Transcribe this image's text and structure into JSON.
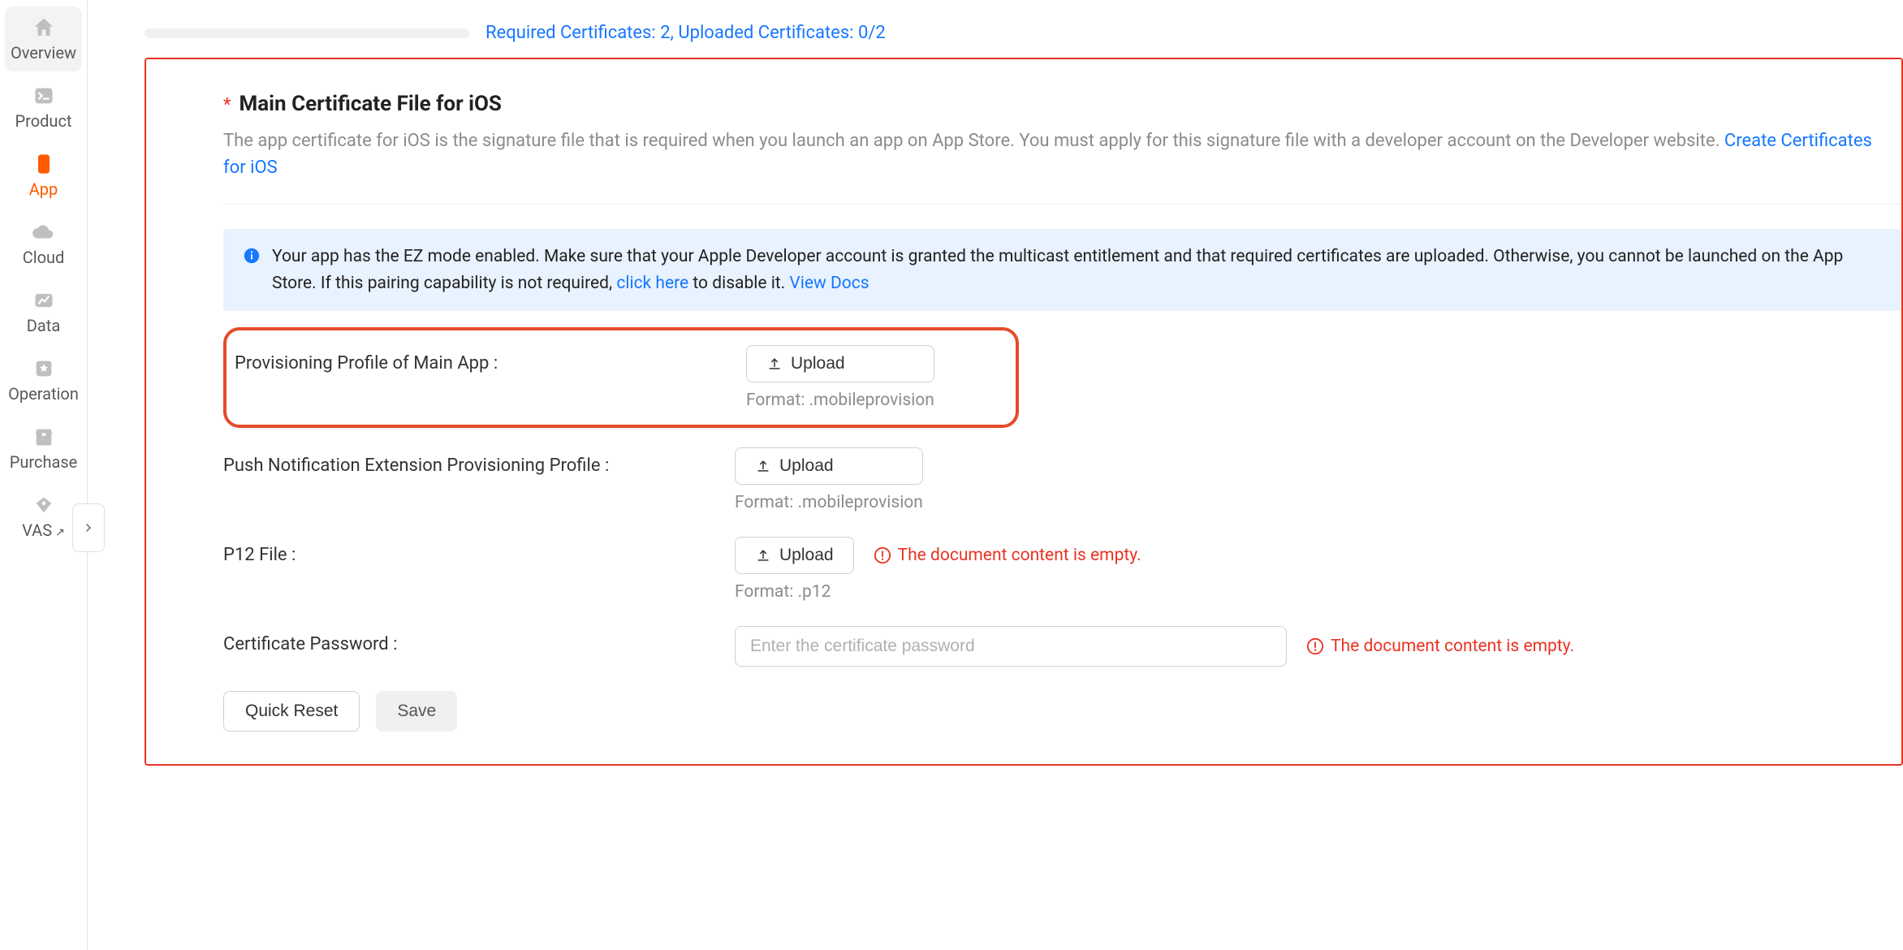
{
  "sidebar": {
    "items": [
      {
        "label": "Overview"
      },
      {
        "label": "Product"
      },
      {
        "label": "App"
      },
      {
        "label": "Cloud"
      },
      {
        "label": "Data"
      },
      {
        "label": "Operation"
      },
      {
        "label": "Purchase"
      },
      {
        "label": "VAS"
      }
    ]
  },
  "progress": {
    "text": "Required Certificates: 2, Uploaded Certificates: 0/2"
  },
  "section": {
    "title": "Main Certificate File for iOS",
    "desc_pre": "The app certificate for iOS is the signature file that is required when you launch an app on App Store. You must apply for this signature file with a developer account on the Developer website. ",
    "desc_link": "Create Certificates for iOS"
  },
  "banner": {
    "text_pre": "Your app has the EZ mode enabled. Make sure that your Apple Developer account is granted the multicast entitlement and that required certificates are uploaded. Otherwise, you cannot be launched on the App Store. If this pairing capability is not required, ",
    "link1": "click here",
    "text_mid": " to disable it. ",
    "link2": "View Docs"
  },
  "rows": {
    "provisioning_main": {
      "label": "Provisioning Profile of Main App :",
      "upload": "Upload",
      "format": "Format:  .mobileprovision"
    },
    "push_ext": {
      "label": "Push Notification Extension Provisioning Profile :",
      "upload": "Upload",
      "format": "Format:  .mobileprovision"
    },
    "p12": {
      "label": "P12 File :",
      "upload": "Upload",
      "format": "Format:  .p12",
      "error": "The document content is empty."
    },
    "cert_password": {
      "label": "Certificate Password :",
      "placeholder": "Enter the certificate password",
      "error": "The document content is empty."
    }
  },
  "buttons": {
    "quick_reset": "Quick Reset",
    "save": "Save"
  }
}
